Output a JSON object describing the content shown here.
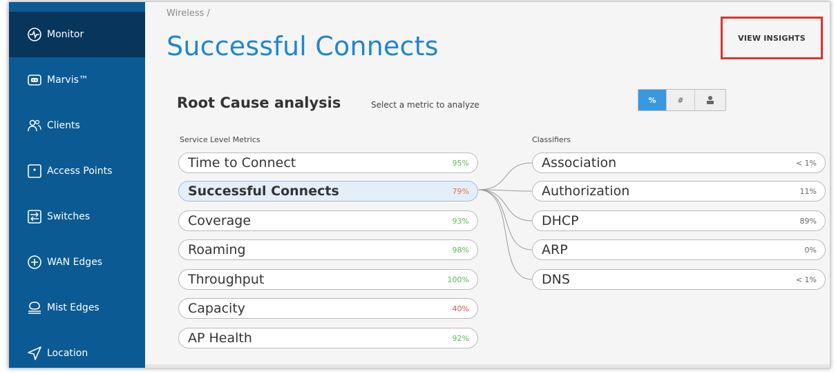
{
  "sidebar": {
    "items": [
      {
        "label": "Monitor",
        "icon": "monitor-pulse-icon",
        "active": true
      },
      {
        "label": "Marvis™",
        "icon": "marvis-icon",
        "active": false
      },
      {
        "label": "Clients",
        "icon": "clients-icon",
        "active": false
      },
      {
        "label": "Access Points",
        "icon": "access-point-icon",
        "active": false
      },
      {
        "label": "Switches",
        "icon": "switch-icon",
        "active": false
      },
      {
        "label": "WAN Edges",
        "icon": "wan-edge-icon",
        "active": false
      },
      {
        "label": "Mist Edges",
        "icon": "mist-edge-icon",
        "active": false
      },
      {
        "label": "Location",
        "icon": "location-icon",
        "active": false
      }
    ]
  },
  "header": {
    "breadcrumb": "Wireless /",
    "title": "Successful Connects",
    "view_insights": "VIEW INSIGHTS"
  },
  "rca": {
    "title": "Root Cause analysis",
    "subtitle": "Select a metric to analyze",
    "toggle": [
      {
        "label": "%",
        "active": true
      },
      {
        "label": "#",
        "active": false
      },
      {
        "label": "user-icon",
        "active": false
      }
    ],
    "metrics_label": "Service Level Metrics",
    "classifiers_label": "Classifiers",
    "metrics": [
      {
        "label": "Time to Connect",
        "value": "95%",
        "color": "#5cb85c"
      },
      {
        "label": "Successful Connects",
        "value": "79%",
        "color": "#e07b39",
        "selected": true
      },
      {
        "label": "Coverage",
        "value": "93%",
        "color": "#5cb85c"
      },
      {
        "label": "Roaming",
        "value": "98%",
        "color": "#5cb85c"
      },
      {
        "label": "Throughput",
        "value": "100%",
        "color": "#5cb85c"
      },
      {
        "label": "Capacity",
        "value": "40%",
        "color": "#d9534f"
      },
      {
        "label": "AP Health",
        "value": "92%",
        "color": "#5cb85c"
      }
    ],
    "classifiers": [
      {
        "label": "Association",
        "value": "< 1%"
      },
      {
        "label": "Authorization",
        "value": "11%"
      },
      {
        "label": "DHCP",
        "value": "89%"
      },
      {
        "label": "ARP",
        "value": "0%"
      },
      {
        "label": "DNS",
        "value": "< 1%"
      }
    ]
  },
  "colors": {
    "sidebar": "#0b5a94",
    "sidebar_active": "#07355c",
    "accent": "#1f86d1",
    "highlight_box": "#e0302a"
  }
}
